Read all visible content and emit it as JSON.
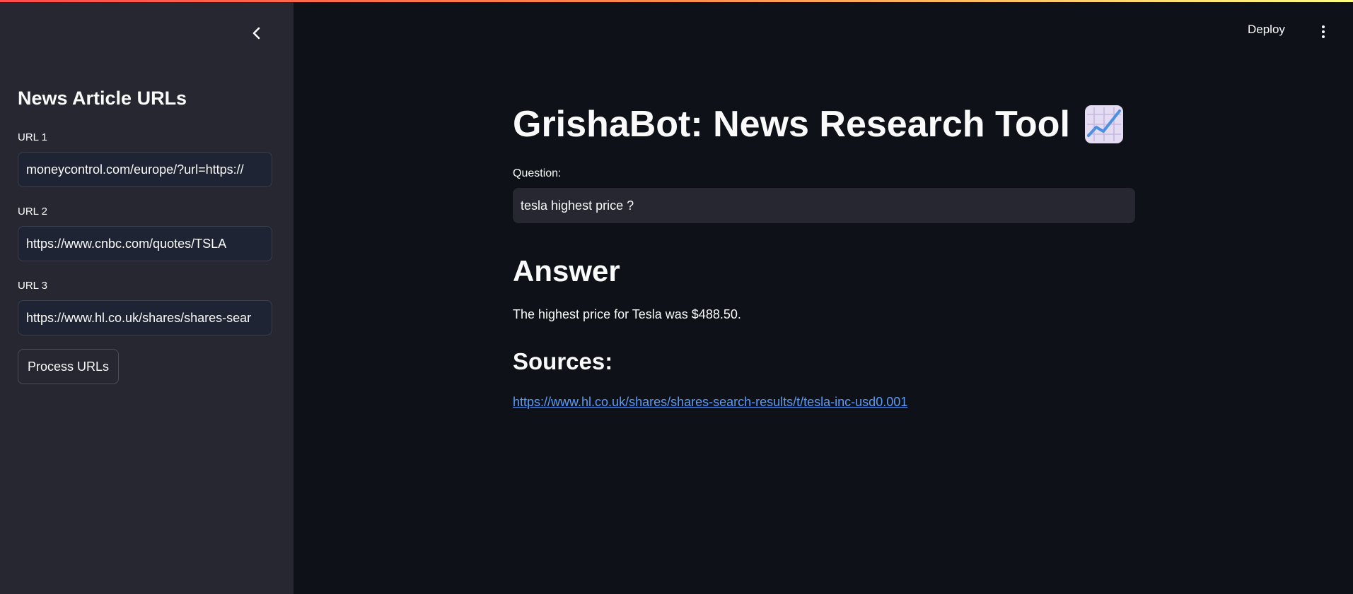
{
  "sidebar": {
    "title": "News Article URLs",
    "fields": [
      {
        "label": "URL 1",
        "value": "moneycontrol.com/europe/?url=https://"
      },
      {
        "label": "URL 2",
        "value": "https://www.cnbc.com/quotes/TSLA"
      },
      {
        "label": "URL 3",
        "value": "https://www.hl.co.uk/shares/shares-sear"
      }
    ],
    "process_button": "Process URLs",
    "collapse_icon": "chevron-left-icon"
  },
  "header": {
    "deploy_label": "Deploy",
    "menu_icon": "kebab-menu-icon",
    "accent_colors": [
      "#ff4b4b",
      "#ff8c4b",
      "#fffd80"
    ]
  },
  "main": {
    "title": "GrishaBot: News Research Tool",
    "title_icon": "chart-increasing-icon",
    "question_label": "Question:",
    "question_value": "tesla highest price ?",
    "answer_heading": "Answer",
    "answer_text": "The highest price for Tesla was $488.50.",
    "sources_heading": "Sources:",
    "sources": [
      "https://www.hl.co.uk/shares/shares-search-results/t/tesla-inc-usd0.001"
    ],
    "link_color": "#5b9bf8"
  }
}
